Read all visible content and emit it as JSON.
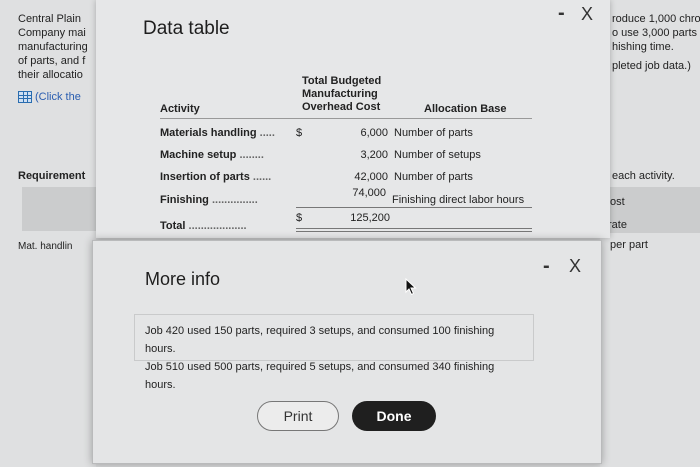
{
  "background_left": {
    "intro_lines": [
      "Central Plain",
      "Company mai",
      "manufacturing",
      "of parts, and f",
      "their allocatio"
    ],
    "click_text": "(Click the",
    "requirement_label": "Requirement",
    "mat_handling": "Mat. handlin"
  },
  "background_right": {
    "lines": [
      "roduce 1,000 chro",
      "o use 3,000 parts",
      "hishing time.",
      "pleted job data.)"
    ],
    "each_activity": "each activity.",
    "cost_label": "ost",
    "rate_label": "rate",
    "per_part": "per part"
  },
  "data_table_window": {
    "title": "Data table",
    "minimize": "-",
    "close": "X",
    "headers": {
      "activity": "Activity",
      "cost_line1": "Total Budgeted",
      "cost_line2": "Manufacturing",
      "cost_line3": "Overhead Cost",
      "allocation_base": "Allocation Base"
    },
    "rows": [
      {
        "activity": "Materials handling",
        "dots": ".....",
        "currency": "$",
        "cost": "6,000",
        "base": "Number of parts"
      },
      {
        "activity": "Machine setup",
        "dots": "........",
        "currency": "",
        "cost": "3,200",
        "base": "Number of setups"
      },
      {
        "activity": "Insertion of parts",
        "dots": "......",
        "currency": "",
        "cost": "42,000",
        "base": "Number of parts"
      },
      {
        "activity": "Finishing",
        "dots": "...............",
        "currency": "",
        "cost": "74,000",
        "base": "Finishing direct labor hours"
      },
      {
        "activity": "Total",
        "dots": "...................",
        "currency": "$",
        "cost": "125,200",
        "base": ""
      }
    ]
  },
  "more_info_window": {
    "title": "More info",
    "minimize": "-",
    "close": "X",
    "info_lines": [
      "Job 420 used 150 parts, required 3 setups, and consumed 100 finishing hours.",
      "Job 510 used 500 parts, required 5 setups, and consumed 340 finishing hours."
    ],
    "print_button": "Print",
    "done_button": "Done"
  },
  "icons": {
    "table_icon": "grid-icon",
    "cursor": "cursor-icon"
  }
}
